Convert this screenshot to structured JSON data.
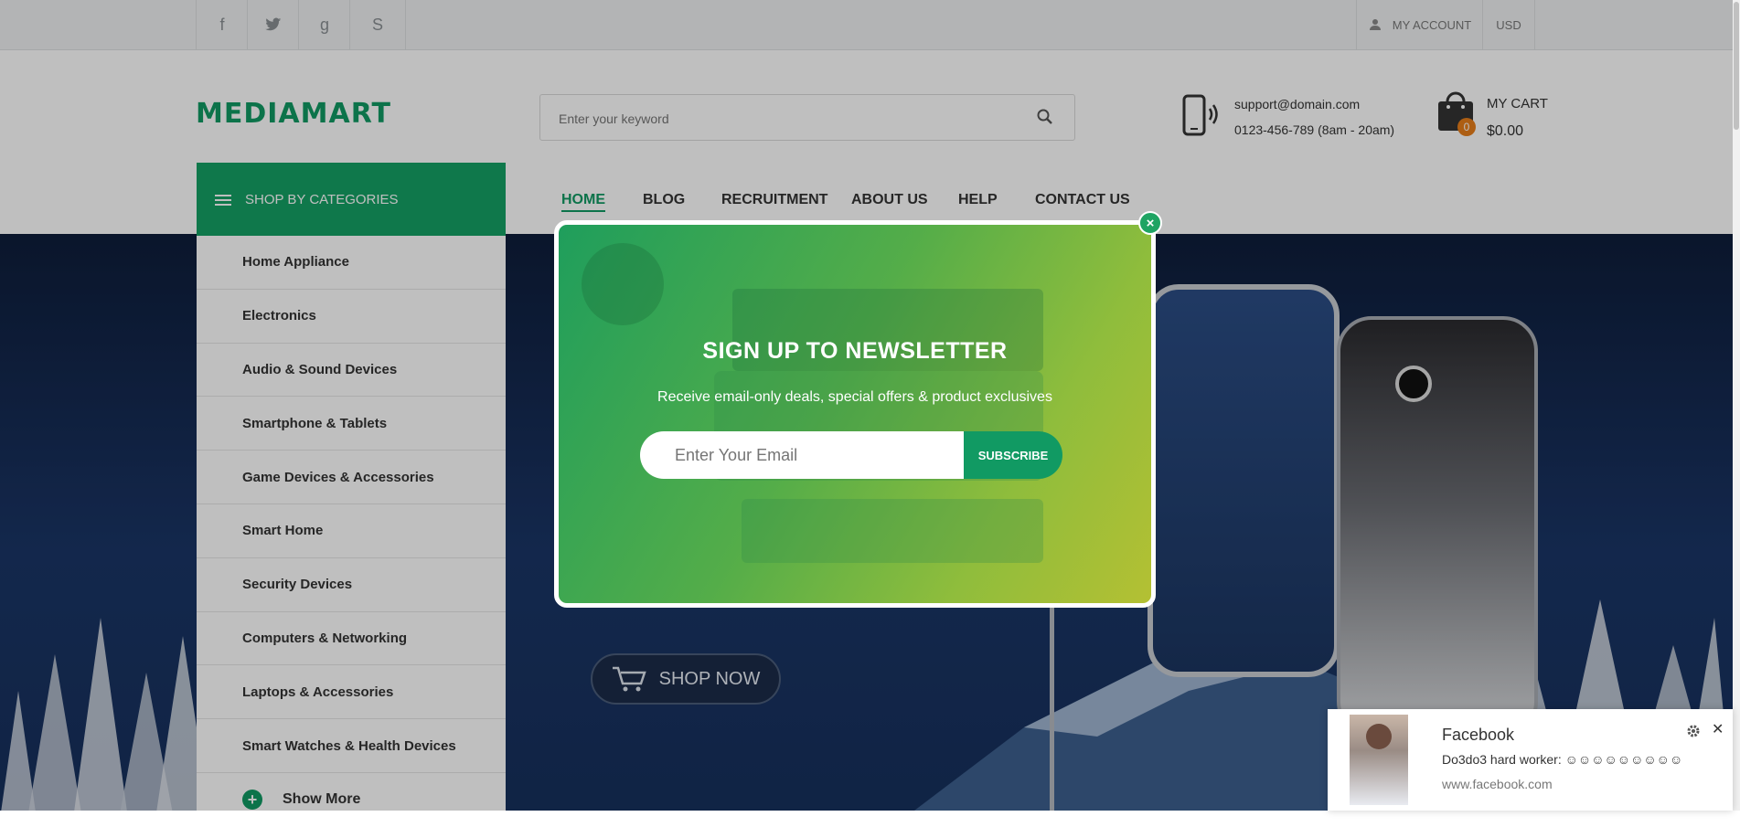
{
  "topbar": {
    "social": [
      {
        "icon": "facebook-icon",
        "glyph": "f"
      },
      {
        "icon": "twitter-icon",
        "glyph": "🐦"
      },
      {
        "icon": "google-icon",
        "glyph": "g"
      },
      {
        "icon": "skype-icon",
        "glyph": "S"
      }
    ],
    "my_account": "MY ACCOUNT",
    "currency": "USD"
  },
  "header": {
    "logo": "MEDIAMART",
    "search_placeholder": "Enter your keyword",
    "support_email": "support@domain.com",
    "phone": "0123-456-789 (8am - 20am)",
    "cart_title": "MY CART",
    "cart_total": "$0.00",
    "cart_count": "0"
  },
  "categories": {
    "title": "SHOP BY CATEGORIES",
    "items": [
      "Home Appliance",
      "Electronics",
      "Audio & Sound Devices",
      "Smartphone & Tablets",
      "Game Devices & Accessories",
      "Smart Home",
      "Security Devices",
      "Computers & Networking",
      "Laptops & Accessories",
      "Smart Watches & Health Devices"
    ],
    "show_more": "Show More"
  },
  "nav": [
    "HOME",
    "BLOG",
    "RECRUITMENT",
    "ABOUT US",
    "HELP",
    "CONTACT US"
  ],
  "banner": {
    "shop_now": "SHOP NOW"
  },
  "newsletter": {
    "title": "SIGN UP TO NEWSLETTER",
    "subtitle": "Receive email-only deals, special offers & product exclusives",
    "email_placeholder": "Enter Your Email",
    "subscribe": "SUBSCRIBE",
    "close": "×"
  },
  "notification": {
    "source": "Facebook",
    "message": "Do3do3 hard worker: ☺☺☺☺☺☺☺☺☺",
    "url": "www.facebook.com",
    "close": "✕"
  },
  "colors": {
    "brand_green": "#119a63",
    "nav_active": "#119a63",
    "topbar_bg": "#eff1f2"
  }
}
